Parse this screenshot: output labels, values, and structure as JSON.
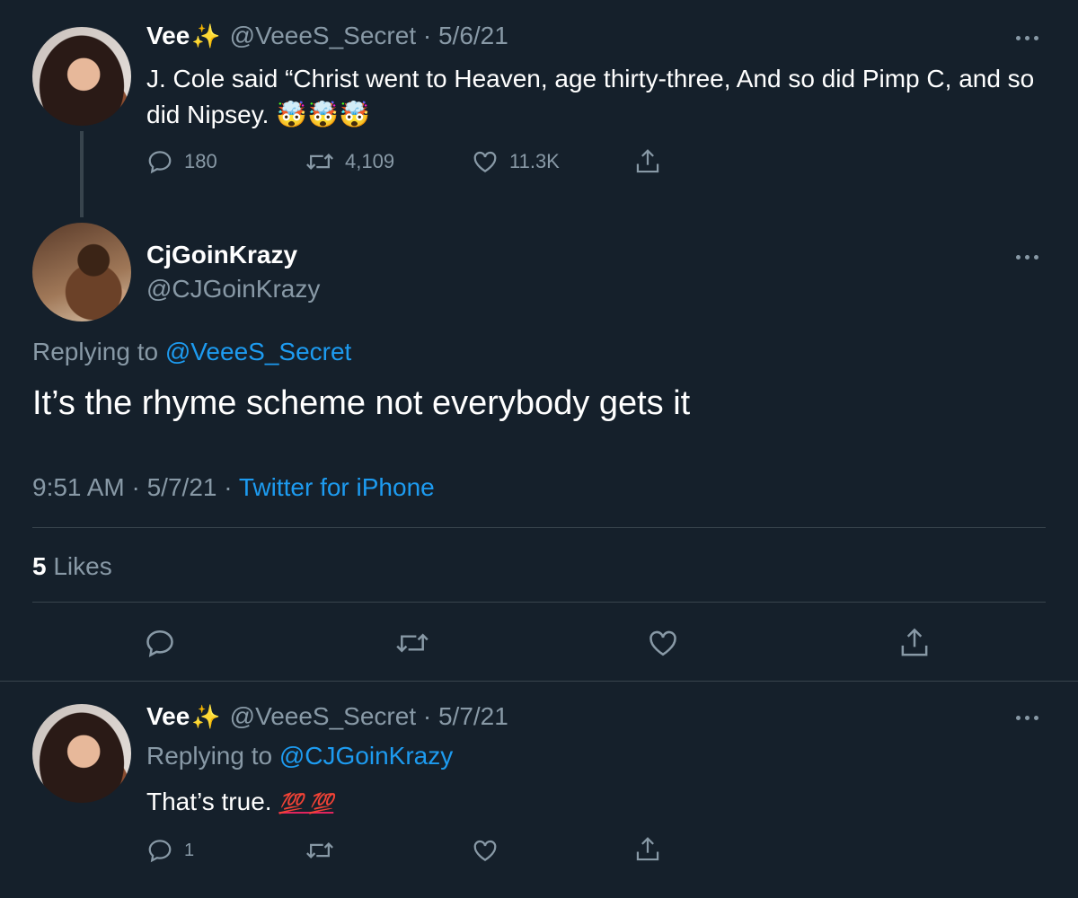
{
  "tweet1": {
    "name": "Vee",
    "sparkle": "✨",
    "handle_meta": "@VeeeS_Secret · 5/6/21",
    "text": "J. Cole said “Christ went to Heaven, age thirty-three, And so did Pimp C, and so did Nipsey.",
    "emoji": "🤯🤯🤯",
    "replies": "180",
    "retweets": "4,109",
    "likes": "11.3K"
  },
  "tweet2": {
    "name": "CjGoinKrazy",
    "handle": "@CJGoinKrazy",
    "replying_prefix": "Replying to",
    "replying_handle": "@VeeeS_Secret",
    "text": "It’s the rhyme scheme not everybody gets it",
    "time_date": "9:51 AM · 5/7/21 · ",
    "source": "Twitter for iPhone",
    "likes_count": "5",
    "likes_label": "Likes"
  },
  "tweet3": {
    "name": "Vee",
    "sparkle": "✨",
    "handle_meta": "@VeeeS_Secret · 5/7/21",
    "replying_prefix": "Replying to",
    "replying_handle": "@CJGoinKrazy",
    "text": "That’s true.",
    "hundred": "💯 💯",
    "replies": "1"
  },
  "icons": {
    "reply": "reply-icon",
    "retweet": "retweet-icon",
    "like": "heart-icon",
    "share": "share-icon",
    "more": "more-icon"
  },
  "colors": {
    "background": "#15202b",
    "muted": "#8899a6",
    "link": "#1d9bf0",
    "divider": "#38444d"
  }
}
